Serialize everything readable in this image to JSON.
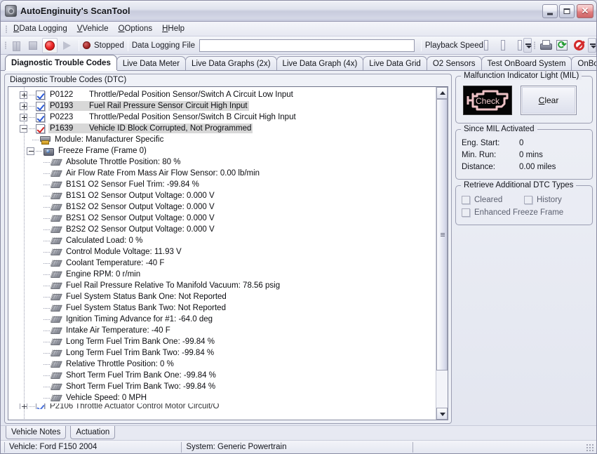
{
  "window": {
    "title": "AutoEnginuity's ScanTool",
    "icon": "app-logo-icon",
    "minimize": "minimize-icon",
    "maximize": "maximize-icon",
    "close": "close-icon"
  },
  "menu": {
    "items": [
      {
        "label": "Data Logging"
      },
      {
        "label": "Vehicle"
      },
      {
        "label": "Options"
      },
      {
        "label": "Help"
      }
    ]
  },
  "toolbar": {
    "pause": "pause-icon",
    "stop": "stop-icon",
    "record": "record-icon",
    "play": "play-icon",
    "status_label": "Stopped",
    "log_file_label": "Data Logging File",
    "log_file_value": "",
    "log_file_placeholder": "",
    "playback_speed_label": "Playback Speed",
    "print": "printer-icon",
    "refresh": "refresh-icon",
    "cancel": "cancel-icon"
  },
  "tabs": {
    "items": [
      {
        "label": "Diagnostic Trouble Codes",
        "selected": true
      },
      {
        "label": "Live Data Meter",
        "selected": false
      },
      {
        "label": "Live Data Graphs (2x)",
        "selected": false
      },
      {
        "label": "Live Data Graph (4x)",
        "selected": false
      },
      {
        "label": "Live Data Grid",
        "selected": false
      },
      {
        "label": "O2 Sensors",
        "selected": false
      },
      {
        "label": "Test OnBoard System",
        "selected": false
      },
      {
        "label": "OnBoard",
        "selected": false
      }
    ],
    "scroll_left": "◁",
    "scroll_right": "▶"
  },
  "dtc": {
    "group_title": "Diagnostic Trouble Codes (DTC)",
    "codes": [
      {
        "code": "P0122",
        "desc": "Throttle/Pedal Position Sensor/Switch A Circuit Low Input",
        "expanded": false,
        "check": "blue",
        "selected": false
      },
      {
        "code": "P0193",
        "desc": "Fuel Rail Pressure Sensor Circuit High Input",
        "expanded": false,
        "check": "blue",
        "selected": true
      },
      {
        "code": "P0223",
        "desc": "Throttle/Pedal Position Sensor/Switch B Circuit High Input",
        "expanded": false,
        "check": "blue",
        "selected": false
      },
      {
        "code": "P1639",
        "desc": "Vehicle ID Block Corrupted, Not Programmed",
        "expanded": true,
        "check": "red",
        "selected": true
      }
    ],
    "module_label": "Module: Manufacturer Specific",
    "freeze_frame_label": "Freeze Frame (Frame 0)",
    "parameters": [
      "Absolute Throttle Position: 80 %",
      "Air Flow Rate From Mass Air Flow Sensor: 0.00 lb/min",
      "B1S1 O2 Sensor Fuel Trim: -99.84 %",
      "B1S1 O2 Sensor Output Voltage: 0.000 V",
      "B1S2 O2 Sensor Output Voltage: 0.000 V",
      "B2S1 O2 Sensor Output Voltage: 0.000 V",
      "B2S2 O2 Sensor Output Voltage: 0.000 V",
      "Calculated Load: 0 %",
      "Control Module Voltage: 11.93 V",
      "Coolant Temperature: -40 F",
      "Engine RPM: 0 r/min",
      "Fuel Rail Pressure Relative To Manifold Vacuum: 78.56 psig",
      "Fuel System Status Bank One: Not Reported",
      "Fuel System Status Bank Two: Not Reported",
      "Ignition Timing Advance for #1: -64.0 deg",
      "Intake Air Temperature: -40 F",
      "Long Term Fuel Trim Bank One: -99.84 %",
      "Long Term Fuel Trim Bank Two: -99.84 %",
      "Relative Throttle Position: 0 %",
      "Short Term Fuel Trim Bank One: -99.84 %",
      "Short Term Fuel Trim Bank Two: -99.84 %",
      "Vehicle Speed: 0 MPH"
    ],
    "next_code_partial": "P2106    Throttle Actuator Control Motor Circuit/O"
  },
  "mil": {
    "group_title": "Malfunction Indicator Light (MIL)",
    "lamp_text": "Check",
    "lamp_color": "#eec3c7",
    "clear_button": "Clear"
  },
  "since_mil": {
    "group_title": "Since MIL Activated",
    "rows": [
      {
        "key": "Eng. Start:",
        "value": "0"
      },
      {
        "key": "Min. Run:",
        "value": "0 mins"
      },
      {
        "key": "Distance:",
        "value": "0.00 miles"
      }
    ]
  },
  "retrieve": {
    "group_title": "Retrieve Additional DTC Types",
    "options": [
      {
        "label": "Cleared",
        "checked": false
      },
      {
        "label": "History",
        "checked": false
      },
      {
        "label": "Enhanced Freeze Frame",
        "checked": false
      }
    ]
  },
  "bottom_tabs": {
    "items": [
      {
        "label": "Vehicle Notes"
      },
      {
        "label": "Actuation"
      }
    ]
  },
  "status_bar": {
    "vehicle": "Vehicle: Ford  F150  2004",
    "system": "System: Generic Powertrain",
    "extra": "",
    "grip": "resize-grip-icon"
  }
}
